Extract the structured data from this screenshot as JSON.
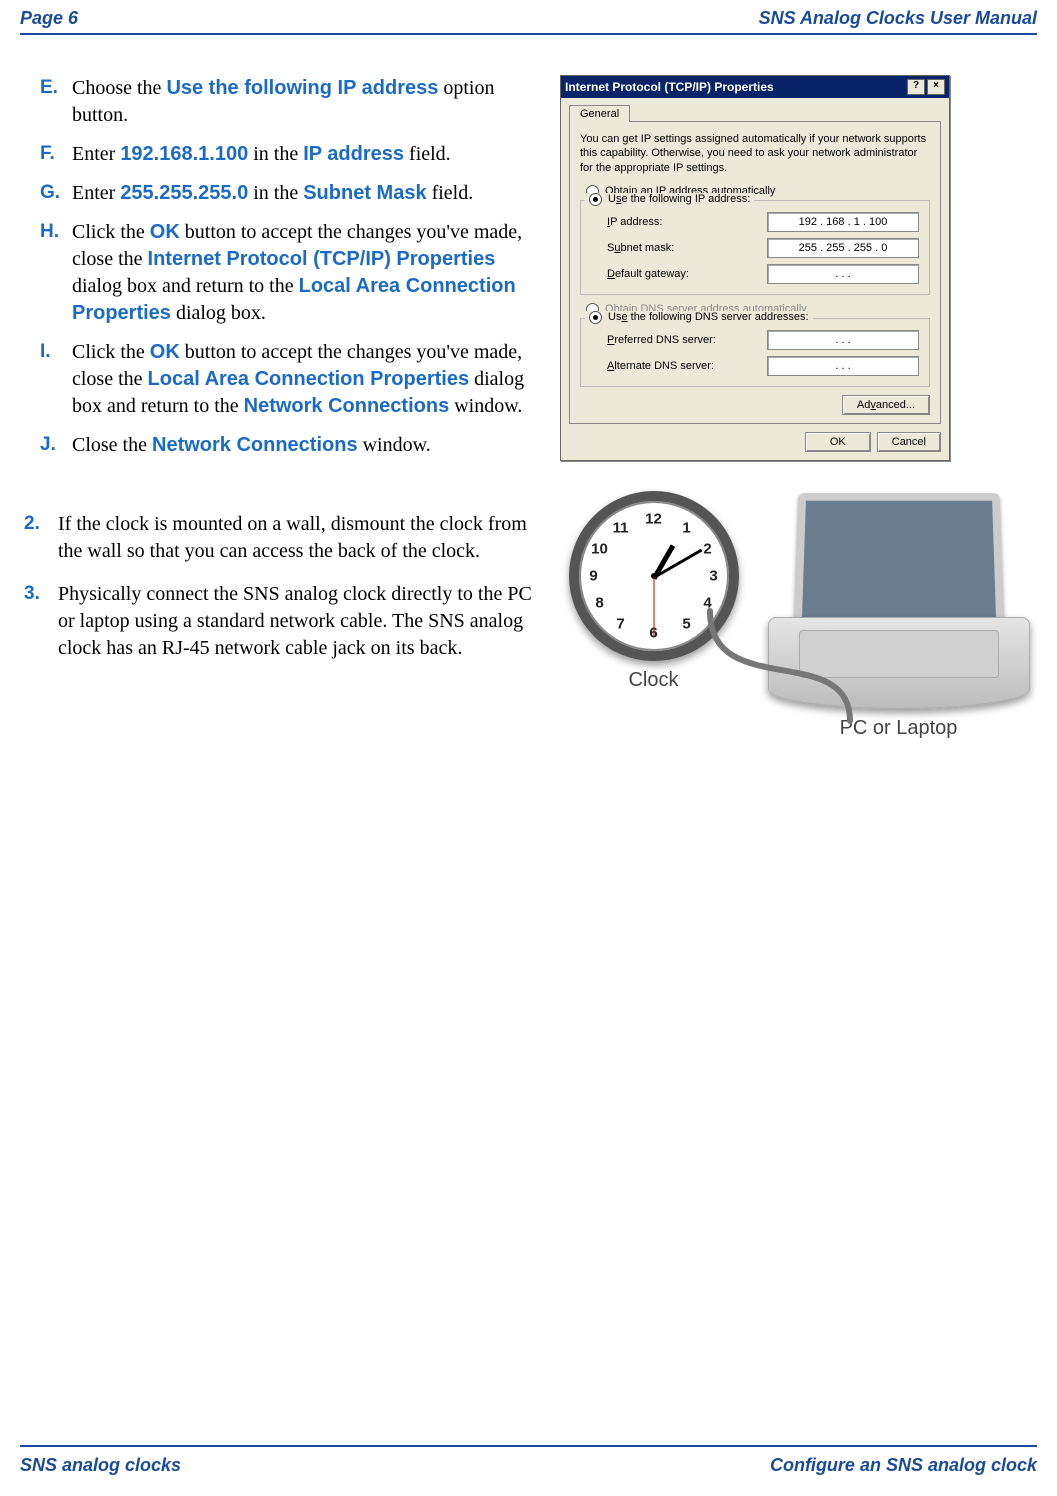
{
  "header": {
    "left": "Page 6",
    "right": "SNS Analog Clocks User Manual"
  },
  "footer": {
    "left": "SNS analog clocks",
    "right": "Configure an SNS analog clock"
  },
  "steps": {
    "E": {
      "marker": "E.",
      "t1": "Choose the ",
      "b1": "Use the following IP address",
      "t2": " option button."
    },
    "F": {
      "marker": "F.",
      "t1": "Enter ",
      "b1": "192.168.1.100",
      "t2": " in the ",
      "b2": "IP address",
      "t3": " field."
    },
    "G": {
      "marker": "G.",
      "t1": "Enter ",
      "b1": "255.255.255.0",
      "t2": " in the ",
      "b2": "Subnet Mask",
      "t3": " field."
    },
    "H": {
      "marker": "H.",
      "t1": "Click the ",
      "b1": "OK",
      "t2": " button to accept the changes you've made, close the ",
      "b2": "Internet Protocol (TCP/IP) Properties",
      "t3": " dialog box and return to the ",
      "b3": "Local Area Connection Properties",
      "t4": " dialog box."
    },
    "I": {
      "marker": "I.",
      "t1": "Click the ",
      "b1": "OK",
      "t2": " button to accept the changes you've made, close the ",
      "b2": "Local Area Connection Properties",
      "t3": " dialog box and return to the ",
      "b3": "Network Connections",
      "t4": " window."
    },
    "J": {
      "marker": "J.",
      "t1": "Close the ",
      "b1": "Network Connections",
      "t2": " window."
    }
  },
  "outer": {
    "s2": {
      "marker": "2.",
      "text": "If the clock is mounted on a wall, dismount the clock from the wall so that you can access the back of the clock."
    },
    "s3": {
      "marker": "3.",
      "text": "Physically connect the SNS analog clock directly to the PC or laptop using a standard network cable. The SNS analog clock has an RJ-45 network cable jack on its back."
    }
  },
  "dialog": {
    "title": "Internet Protocol (TCP/IP) Properties",
    "help_btn": "?",
    "close_btn": "×",
    "tab": "General",
    "desc": "You can get IP settings assigned automatically if your network supports this capability. Otherwise, you need to ask your network administrator for the appropriate IP settings.",
    "r_obtain_ip": "Obtain an IP address automatically",
    "r_use_ip": "Use the following IP address:",
    "lbl_ip": "IP address:",
    "val_ip": "192 . 168 .   1  . 100",
    "lbl_subnet": "Subnet mask:",
    "val_subnet": "255 . 255 . 255 .   0",
    "lbl_gateway": "Default gateway:",
    "val_gateway": ".        .        .",
    "r_obtain_dns": "Obtain DNS server address automatically",
    "r_use_dns": "Use the following DNS server addresses:",
    "lbl_pref_dns": "Preferred DNS server:",
    "val_pref_dns": ".        .        .",
    "lbl_alt_dns": "Alternate DNS server:",
    "val_alt_dns": ".        .        .",
    "btn_adv": "Advanced...",
    "btn_ok": "OK",
    "btn_cancel": "Cancel"
  },
  "illus": {
    "clock_label": "Clock",
    "lp_label": "PC or Laptop",
    "clock_numbers": {
      "n12": "12",
      "n1": "1",
      "n2": "2",
      "n3": "3",
      "n4": "4",
      "n5": "5",
      "n6": "6",
      "n7": "7",
      "n8": "8",
      "n9": "9",
      "n10": "10",
      "n11": "11"
    }
  }
}
